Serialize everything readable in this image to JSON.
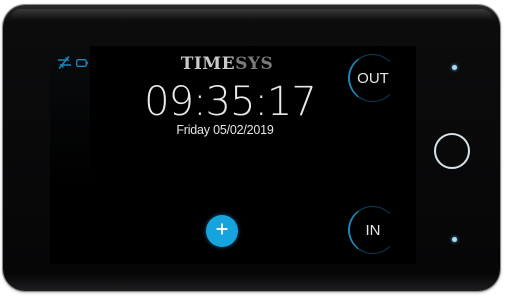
{
  "brand": {
    "part1": "TIME",
    "part2": "SYS"
  },
  "clock": {
    "time": "09:35:17",
    "date": "Friday 05/02/2019"
  },
  "actions": {
    "out_label": "OUT",
    "in_label": "IN"
  },
  "icons": {
    "sync": "sync-disabled-icon",
    "battery": "battery-icon",
    "add": "plus-icon",
    "home": "home-button-ring"
  },
  "colors": {
    "accent": "#17a4de",
    "ring": "#1f86b8",
    "text": "#e9e9e9",
    "led": "#a9dcf5"
  }
}
